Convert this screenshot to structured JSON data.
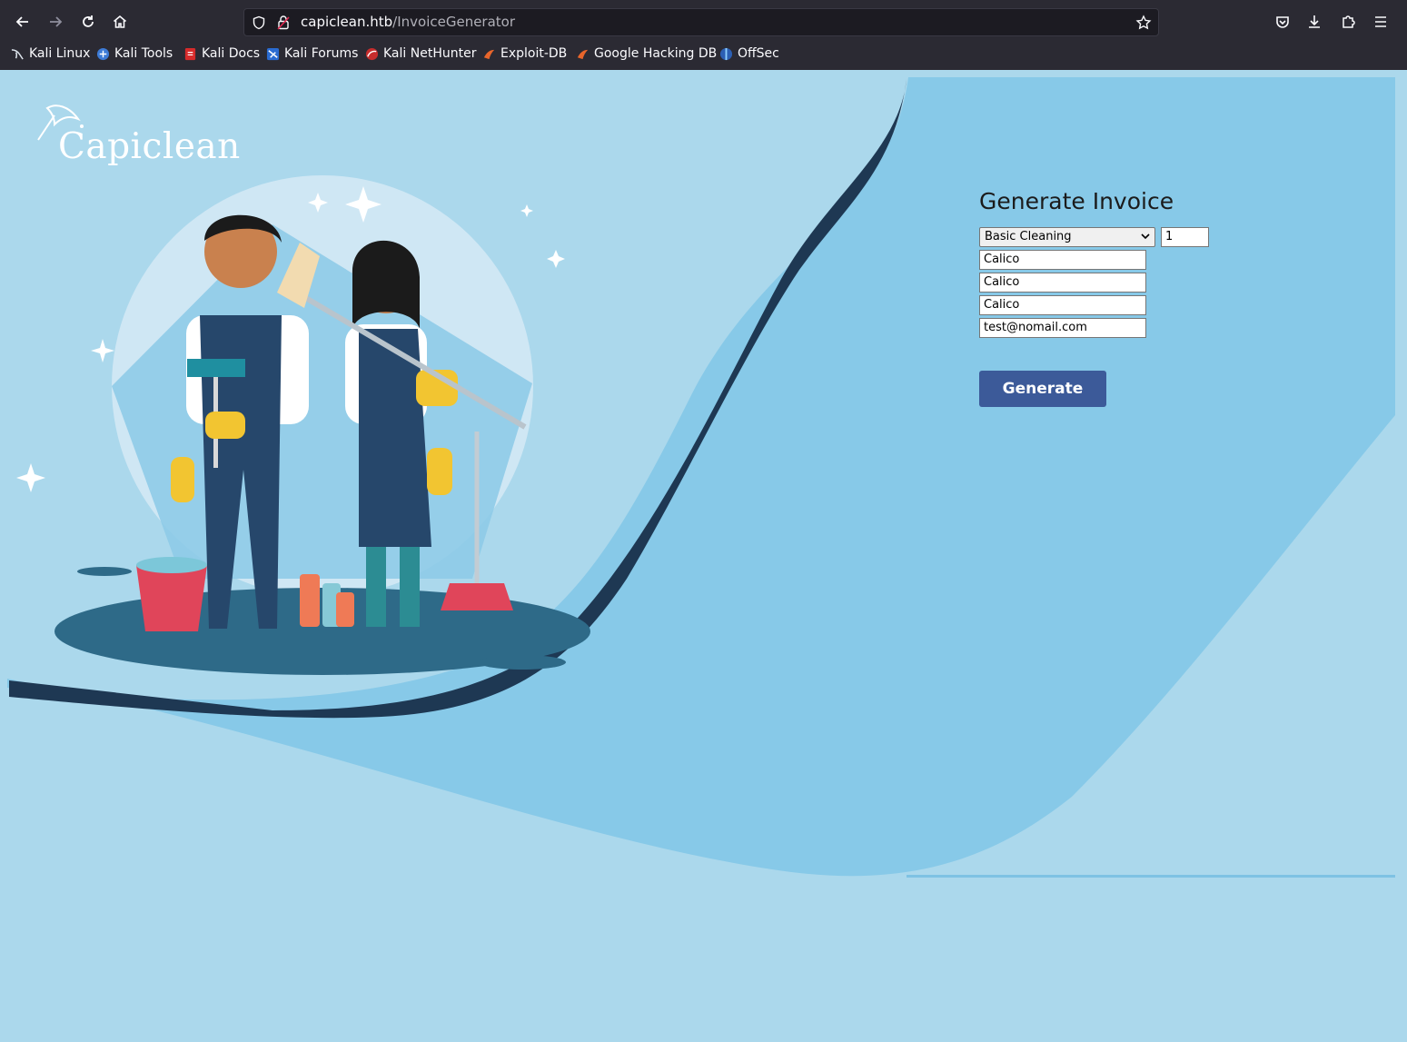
{
  "browser": {
    "url_host": "capiclean.htb",
    "url_path": "/InvoiceGenerator",
    "bookmarks": [
      {
        "label": "Kali Linux",
        "icon": "kali-dragon-icon"
      },
      {
        "label": "Kali Tools",
        "icon": "kali-tools-icon"
      },
      {
        "label": "Kali Docs",
        "icon": "kali-docs-icon"
      },
      {
        "label": "Kali Forums",
        "icon": "kali-forums-icon"
      },
      {
        "label": "Kali NetHunter",
        "icon": "kali-nethunter-icon"
      },
      {
        "label": "Exploit-DB",
        "icon": "exploit-db-icon"
      },
      {
        "label": "Google Hacking DB",
        "icon": "ghdb-icon"
      },
      {
        "label": "OffSec",
        "icon": "offsec-icon"
      }
    ]
  },
  "site": {
    "logo_text": "Capiclean"
  },
  "form": {
    "title": "Generate Invoice",
    "service_selected": "Basic Cleaning",
    "quantity": "1",
    "field1": "Calico",
    "field2": "Calico",
    "field3": "Calico",
    "email": "test@nomail.com",
    "submit_label": "Generate"
  },
  "colors": {
    "page_bg": "#abd8ec",
    "panel_bg": "#87c9e8",
    "button_bg": "#3c5a99",
    "chrome_bg": "#2b2a33"
  }
}
